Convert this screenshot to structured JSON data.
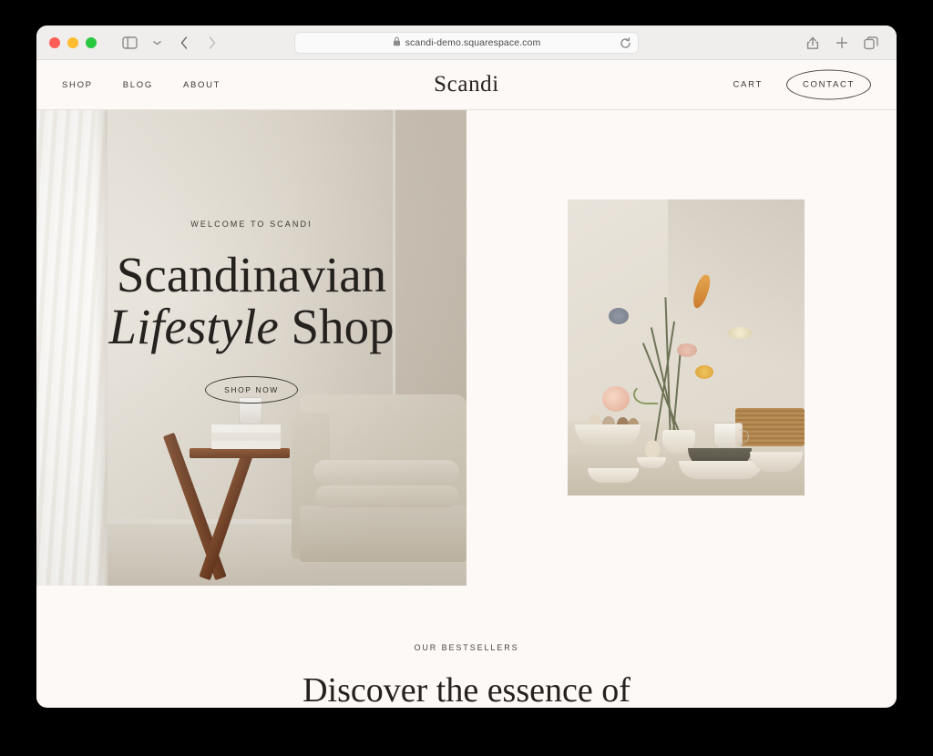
{
  "browser": {
    "traffic_lights": [
      "close",
      "minimize",
      "maximize"
    ],
    "sidebar_icon": "sidebar-toggle-icon",
    "dropdown_icon": "chevron-down-icon",
    "back_icon": "back-arrow-icon",
    "forward_icon": "forward-arrow-icon",
    "url": "scandi-demo.squarespace.com",
    "lock_icon": "lock-icon",
    "reload_icon": "reload-icon",
    "share_icon": "share-icon",
    "new_tab_icon": "plus-icon",
    "tab_overview_icon": "tab-overview-icon"
  },
  "site": {
    "logo": "Scandi",
    "nav": [
      {
        "label": "SHOP"
      },
      {
        "label": "BLOG"
      },
      {
        "label": "ABOUT"
      }
    ],
    "cart_label": "CART",
    "contact_label": "CONTACT"
  },
  "hero": {
    "eyebrow": "WELCOME TO SCANDI",
    "title_line1": "Scandinavian",
    "title_italic": "Lifestyle",
    "title_rest": " Shop",
    "cta_label": "SHOP NOW",
    "image_alt": "wooden-stool-with-books-and-sofa-interior"
  },
  "feature_image": {
    "alt": "still-life-flowers-vase-eggs-ceramics-table"
  },
  "bestsellers": {
    "eyebrow": "OUR BESTSELLERS",
    "heading": "Discover the essence of"
  },
  "colors": {
    "page_bg": "#fdf9f6",
    "toolbar_bg": "#f0eeec",
    "text": "#3a3733",
    "heading": "#24211e",
    "outer_bg": "#000000"
  }
}
